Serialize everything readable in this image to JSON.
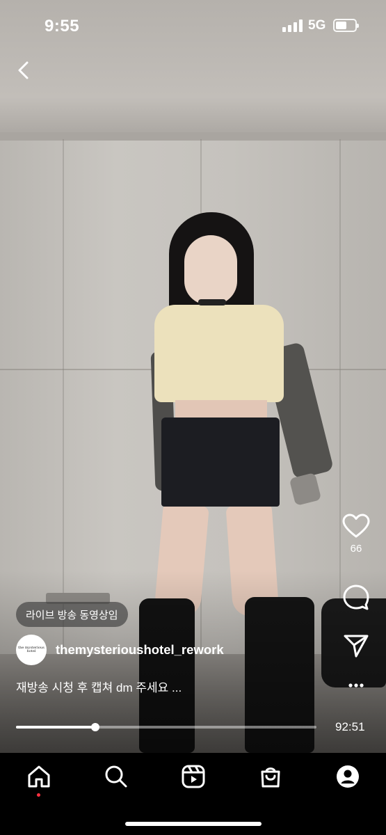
{
  "status_bar": {
    "time": "9:55",
    "network": "5G",
    "battery_level": 0.58
  },
  "header": {
    "back_icon": "chevron-left-icon"
  },
  "actions": {
    "like_icon": "heart-icon",
    "like_count": "66",
    "comment_icon": "comment-bubble-icon",
    "share_icon": "paper-plane-icon",
    "more_icon": "more-dots-icon"
  },
  "post": {
    "badge": "라이브 방송 동영상임",
    "avatar_text": "the mysterious hotel",
    "username": "themysterioushotel_rework",
    "caption": "재방송 시청 후 캡쳐 dm 주세요 ..."
  },
  "player": {
    "progress": 0.265,
    "duration": "92:51"
  },
  "bottom_nav": {
    "items": [
      {
        "icon": "home-icon",
        "active": true
      },
      {
        "icon": "search-icon"
      },
      {
        "icon": "reels-icon"
      },
      {
        "icon": "shop-icon"
      },
      {
        "icon": "profile-icon"
      }
    ],
    "notification_color": "#ff3040"
  }
}
